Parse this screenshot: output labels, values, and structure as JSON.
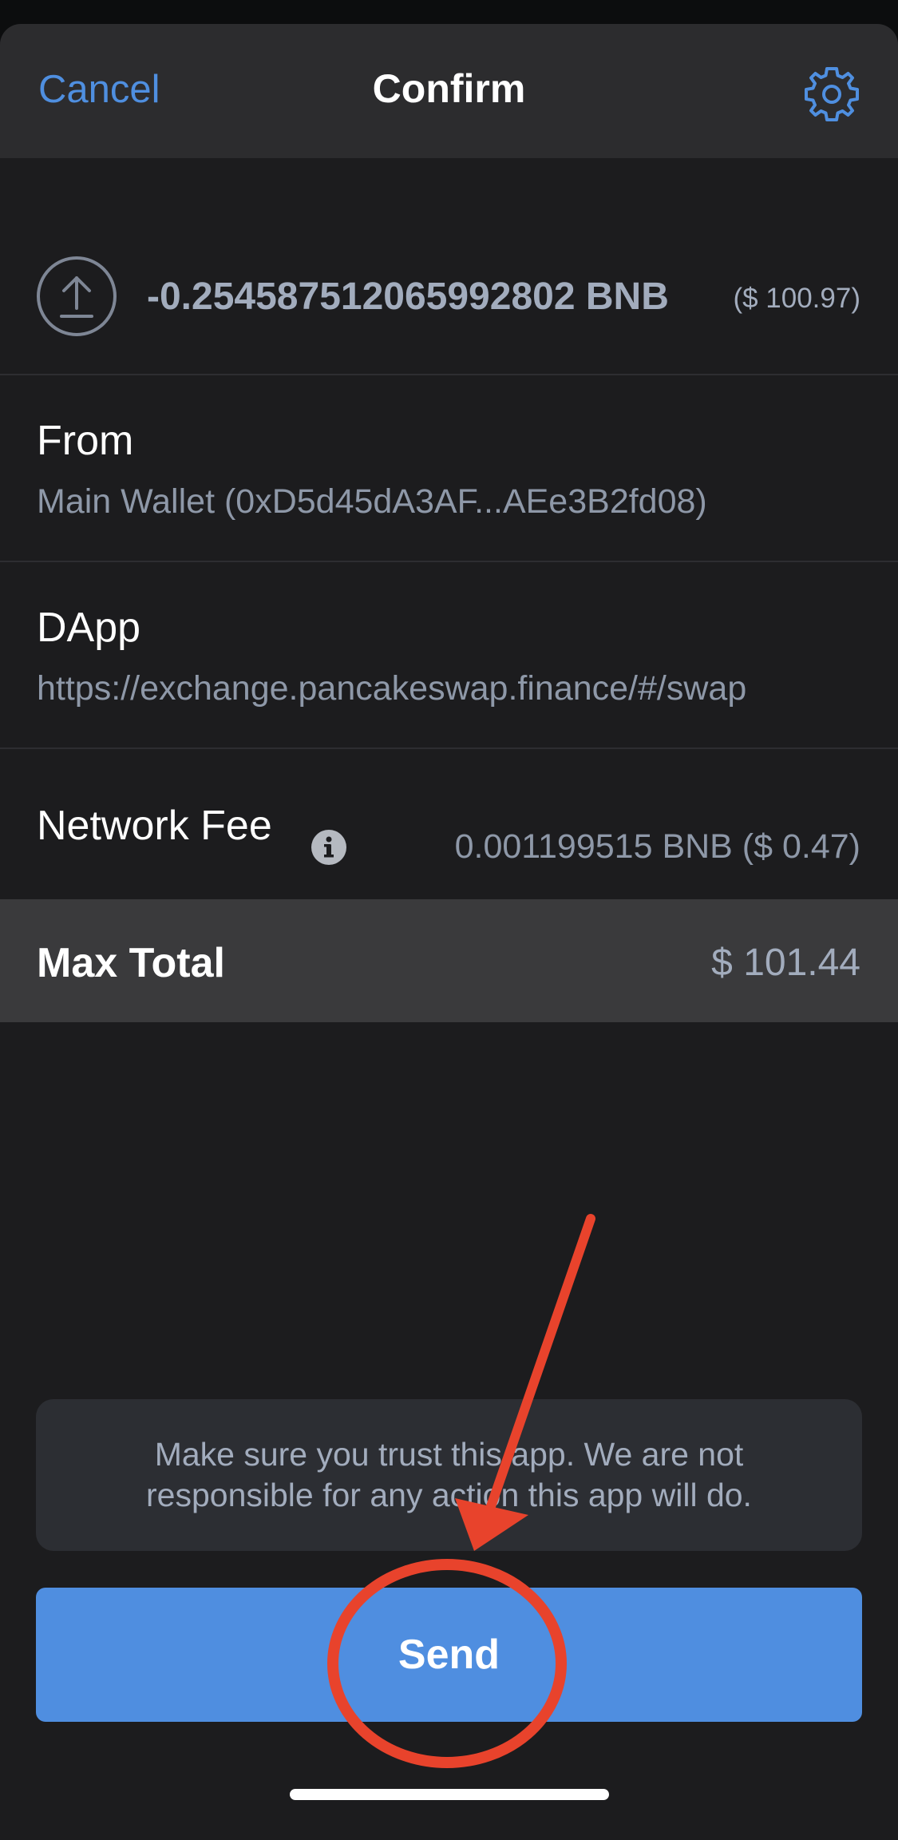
{
  "nav": {
    "cancel_label": "Cancel",
    "title": "Confirm"
  },
  "transaction": {
    "amount": "-0.254587512065992802 BNB",
    "amount_usd": "($ 100.97)"
  },
  "from": {
    "label": "From",
    "value": "Main Wallet (0xD5d45dA3AF...AEe3B2fd08)"
  },
  "dapp": {
    "label": "DApp",
    "value": "https://exchange.pancakeswap.finance/#/swap"
  },
  "network_fee": {
    "label": "Network Fee",
    "value": "0.001199515 BNB ($ 0.47)"
  },
  "max_total": {
    "label": "Max Total",
    "value": "$ 101.44"
  },
  "warning": {
    "text": "Make sure you trust this app. We are not responsible for any action this app will do."
  },
  "send_button": {
    "label": "Send"
  },
  "icons": {
    "settings": "gear-icon",
    "transaction": "upload-icon",
    "fee_info": "info-icon"
  },
  "colors": {
    "accent": "#4f8ee0",
    "annotation": "#e8432c",
    "background": "#1c1c1e"
  }
}
